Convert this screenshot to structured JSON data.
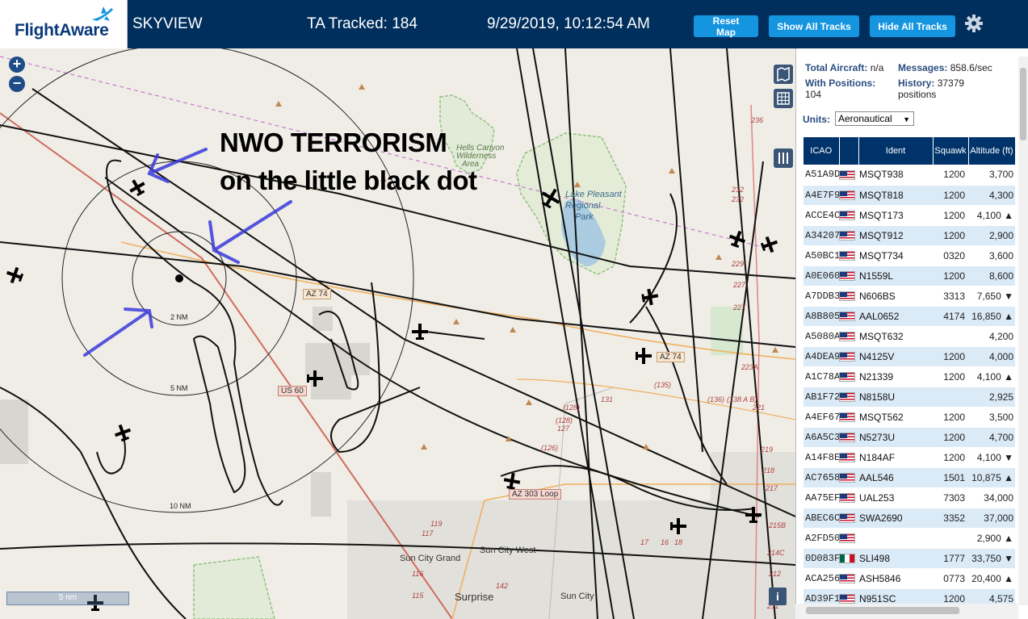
{
  "header": {
    "logo_text": "FlightAware",
    "app_name": "SKYVIEW",
    "tracked": "TA Tracked: 184",
    "datetime": "9/29/2019, 10:12:54 AM",
    "reset_label": "Reset Map",
    "show_label": "Show All Tracks",
    "hide_label": "Hide All Tracks",
    "settings_icon": "gear-icon"
  },
  "overlay": {
    "line1": "NWO TERRORISM",
    "line2": "on the little black dot"
  },
  "map": {
    "zoom_in": "+",
    "zoom_out": "−",
    "scale_label": "5 nm",
    "info_label": "i",
    "ring_labels": [
      "2 NM",
      "5 NM",
      "10 NM"
    ],
    "area_labels": [
      "Hells Canyon",
      "Wilderness",
      "Area",
      "Lake Pleasant",
      "Regional",
      "Park",
      "Sun City Grand",
      "Sun City West",
      "Surprise",
      "Sun City"
    ],
    "road_labels": [
      "AZ 74",
      "AZ 74",
      "US 60",
      "AZ 303 Loop"
    ],
    "route_numbers": [
      "236",
      "232",
      "232",
      "229",
      "227",
      "227",
      "223A",
      "221",
      "219",
      "218",
      "217",
      "215B",
      "214C",
      "212",
      "211",
      "131",
      "(128)",
      "(128)",
      "127",
      "(126)",
      "(135)",
      "(136)",
      "(138 A B)",
      "119",
      "117",
      "116",
      "115",
      "142",
      "17",
      "16",
      "18"
    ]
  },
  "sidebar": {
    "total_label": "Total Aircraft:",
    "total_value": "n/a",
    "positions_label": "With Positions:",
    "positions_value": "104",
    "messages_label": "Messages:",
    "messages_value": "858.6/sec",
    "history_label": "History:",
    "history_value": "37379",
    "history_unit": "positions",
    "units_label": "Units:",
    "units_value": "Aeronautical",
    "columns": [
      "ICAO",
      "",
      "Ident",
      "Squawk",
      "Altitude (ft)"
    ],
    "rows": [
      {
        "icao": "A51A9D",
        "flag": "us",
        "ident": "MSQT938",
        "squawk": "1200",
        "alt": "3,700"
      },
      {
        "icao": "A4E7F9",
        "flag": "us",
        "ident": "MSQT818",
        "squawk": "1200",
        "alt": "4,300"
      },
      {
        "icao": "ACCE4C",
        "flag": "us",
        "ident": "MSQT173",
        "squawk": "1200",
        "alt": "4,100 ▲"
      },
      {
        "icao": "A34207",
        "flag": "us",
        "ident": "MSQT912",
        "squawk": "1200",
        "alt": "2,900"
      },
      {
        "icao": "A50BC1",
        "flag": "us",
        "ident": "MSQT734",
        "squawk": "0320",
        "alt": "3,600"
      },
      {
        "icao": "A0E060",
        "flag": "us",
        "ident": "N1559L",
        "squawk": "1200",
        "alt": "8,600"
      },
      {
        "icao": "A7DDB3",
        "flag": "us",
        "ident": "N606BS",
        "squawk": "3313",
        "alt": "7,650 ▼"
      },
      {
        "icao": "A8B805",
        "flag": "us",
        "ident": "AAL0652",
        "squawk": "4174",
        "alt": "16,850 ▲"
      },
      {
        "icao": "A5080A",
        "flag": "us",
        "ident": "MSQT632",
        "squawk": "",
        "alt": "4,200"
      },
      {
        "icao": "A4DEA9",
        "flag": "us",
        "ident": "N4125V",
        "squawk": "1200",
        "alt": "4,000"
      },
      {
        "icao": "A1C78A",
        "flag": "us",
        "ident": "N21339",
        "squawk": "1200",
        "alt": "4,100 ▲"
      },
      {
        "icao": "AB1F72",
        "flag": "us",
        "ident": "N8158U",
        "squawk": "",
        "alt": "2,925"
      },
      {
        "icao": "A4EF67",
        "flag": "us",
        "ident": "MSQT562",
        "squawk": "1200",
        "alt": "3,500"
      },
      {
        "icao": "A6A5C3",
        "flag": "us",
        "ident": "N5273U",
        "squawk": "1200",
        "alt": "4,700"
      },
      {
        "icao": "A14F8E",
        "flag": "us",
        "ident": "N184AF",
        "squawk": "1200",
        "alt": "4,100 ▼"
      },
      {
        "icao": "AC7658",
        "flag": "us",
        "ident": "AAL546",
        "squawk": "1501",
        "alt": "10,875 ▲"
      },
      {
        "icao": "AA75EF",
        "flag": "us",
        "ident": "UAL253",
        "squawk": "7303",
        "alt": "34,000"
      },
      {
        "icao": "ABEC6C",
        "flag": "us",
        "ident": "SWA2690",
        "squawk": "3352",
        "alt": "37,000"
      },
      {
        "icao": "A2FD50",
        "flag": "us",
        "ident": "",
        "squawk": "",
        "alt": "2,900 ▲"
      },
      {
        "icao": "0D083F",
        "flag": "mx",
        "ident": "SLI498",
        "squawk": "1777",
        "alt": "33,750 ▼"
      },
      {
        "icao": "ACA256",
        "flag": "us",
        "ident": "ASH5846",
        "squawk": "0773",
        "alt": "20,400 ▲"
      },
      {
        "icao": "AD39F1",
        "flag": "us",
        "ident": "N951SC",
        "squawk": "1200",
        "alt": "4,575"
      }
    ]
  },
  "colors": {
    "header_bg": "#002f5d",
    "button_bg": "#1595e0",
    "table_header": "#00336a",
    "row_alt": "#dbeaf7",
    "water": "#aacbe0",
    "park_border": "#8fc27e",
    "road_orange": "#f0b060",
    "pen_blue": "#3a3adc"
  }
}
